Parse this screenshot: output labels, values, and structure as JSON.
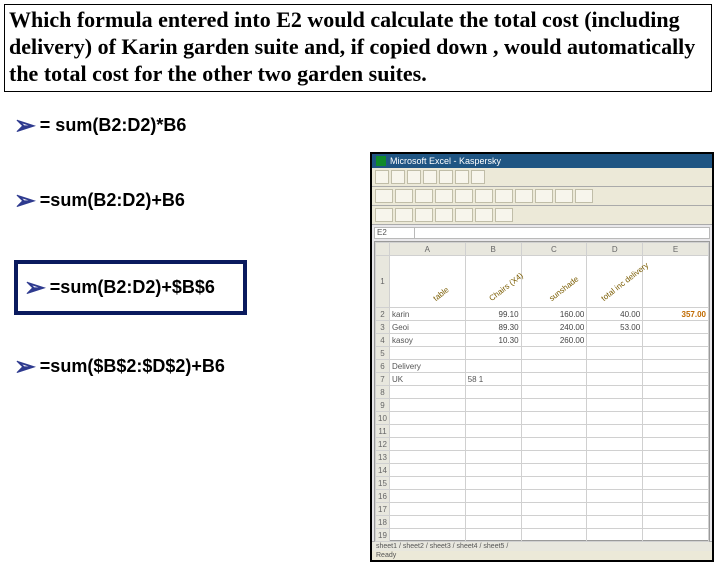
{
  "question": "Which formula entered into E2 would calculate the total cost (including delivery) of Karin garden suite and, if copied down , would automatically the total cost for the other two garden suites.",
  "options": {
    "a": "= sum(B2:D2)*B6",
    "b": "=sum(B2:D2)+B6",
    "c": "=sum(B2:D2)+$B$6",
    "d": "=sum($B$2:$D$2)+B6"
  },
  "excel": {
    "title": "Microsoft Excel - Kaspersky",
    "namebox": "E2",
    "headers": {
      "A": "A",
      "B": "B",
      "C": "C",
      "D": "D",
      "E": "E"
    },
    "rotated": {
      "b": "table",
      "c": "Chairs (X4)",
      "d": "sunshade",
      "e": "total inc delivery"
    },
    "rows": {
      "r1": {
        "num": "1",
        "a": ""
      },
      "r2": {
        "num": "2",
        "a": "karin",
        "b": "99.10",
        "c": "160.00",
        "d": "40.00",
        "e": "357.00"
      },
      "r3": {
        "num": "3",
        "a": "Geoi",
        "b": "89.30",
        "c": "240.00",
        "d": "53.00"
      },
      "r4": {
        "num": "4",
        "a": "kasoy",
        "b": "10.30",
        "c": "260.00",
        "d": ""
      },
      "r5": {
        "num": "5"
      },
      "r6": {
        "num": "6",
        "a": "Delivery"
      },
      "r7": {
        "num": "7",
        "a": "UK",
        "b": "58 1"
      },
      "r8": {
        "num": "8"
      },
      "r9": {
        "num": "9"
      },
      "r10": {
        "num": "10"
      },
      "r11": {
        "num": "11"
      },
      "r12": {
        "num": "12"
      },
      "r13": {
        "num": "13"
      },
      "r14": {
        "num": "14"
      },
      "r15": {
        "num": "15"
      },
      "r16": {
        "num": "16"
      },
      "r17": {
        "num": "17"
      },
      "r18": {
        "num": "18"
      },
      "r19": {
        "num": "19"
      }
    },
    "tabs": "sheet1 / sheet2 / sheet3 / sheet4 / sheet5 /",
    "status": "Ready"
  }
}
